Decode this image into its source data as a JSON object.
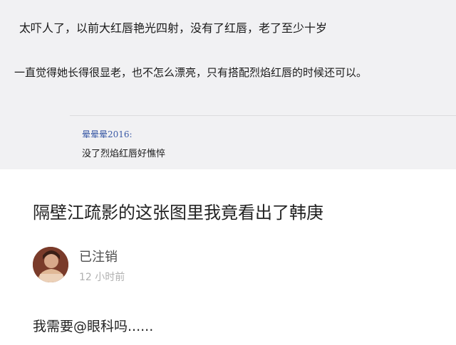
{
  "top_comment": {
    "line1": "太吓人了，以前大红唇艳光四射，没有了红唇，老了至少十岁",
    "line2": "一直觉得她长得很显老，也不怎么漂亮，只有搭配烈焰红唇的时候还可以。",
    "reply": {
      "username": "晕晕晕2016:",
      "text": "没了烈焰红唇好憔悴"
    }
  },
  "bottom_post": {
    "title": "隔壁江疏影的这张图里我竟看出了韩庚",
    "comment": {
      "avatar_icon": "user-avatar-photo",
      "username": "已注销",
      "time": "12 小时前",
      "body": "我需要@眼科吗......"
    }
  }
}
